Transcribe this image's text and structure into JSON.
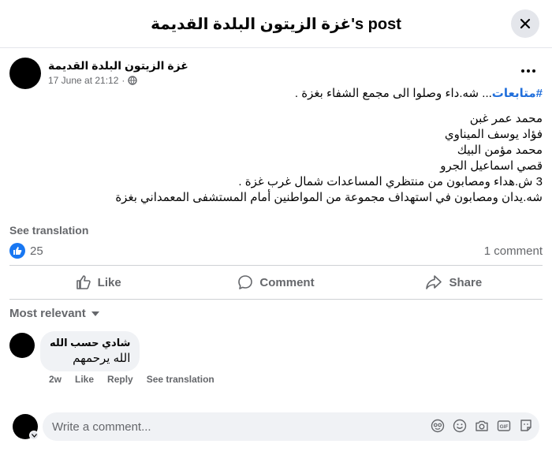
{
  "header": {
    "title": "غزة الزيتون البلدة القديمة's post"
  },
  "post": {
    "author": "غزة الزيتون البلدة القديمة",
    "timestamp": "17 June at 21:12",
    "separator": "·",
    "hashtag": "#متابعات",
    "intro": "... شه.داء وصلوا الى مجمع الشفاء بغزة .",
    "names": [
      "محمد عمر غبن",
      "فؤاد يوسف الميناوي",
      "محمد مؤمن البيك",
      "قصي اسماعيل الجرو"
    ],
    "line1": "3 ش.هداء ومصابون من منتظري المساعدات شمال غرب غزة .",
    "line2": "شه.يدان ومصابون في استهداف مجموعة من المواطنين أمام المستشفى المعمداني بغزة",
    "see_translation": "See translation",
    "reaction_count": "25",
    "comment_count": "1 comment"
  },
  "actions": {
    "like": "Like",
    "comment": "Comment",
    "share": "Share"
  },
  "filter": {
    "label": "Most relevant"
  },
  "comment": {
    "author": "شادي حسب الله",
    "text": "الله يرحمهم",
    "age": "2w",
    "like": "Like",
    "reply": "Reply",
    "see_translation": "See translation"
  },
  "composer": {
    "placeholder": "Write a comment..."
  },
  "icons": {
    "close": "close-icon",
    "more": "more-icon",
    "globe": "globe-icon",
    "like_badge": "like-icon",
    "like": "thumb-up-icon",
    "comment": "comment-icon",
    "share": "share-icon",
    "chevron": "chevron-down-icon",
    "avatar_sticker": "avatar-sticker-icon",
    "emoji": "emoji-icon",
    "camera": "camera-icon",
    "gif": "gif-icon",
    "sticker": "sticker-icon"
  },
  "colors": {
    "accent": "#1877f2",
    "hashtag": "#216fdb",
    "muted": "#65676b",
    "surface": "#f0f2f5"
  }
}
